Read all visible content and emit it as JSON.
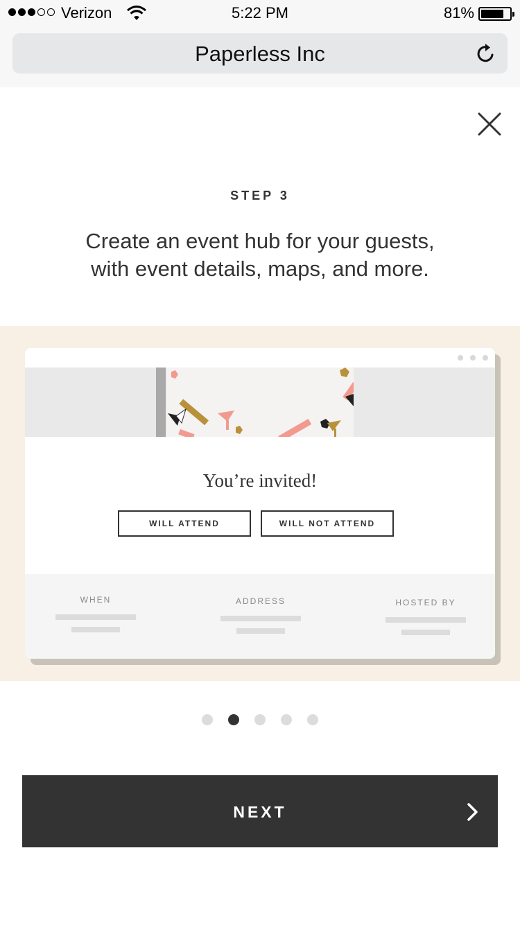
{
  "status_bar": {
    "carrier": "Verizon",
    "signal_bars_filled": 3,
    "signal_bars_total": 5,
    "time": "5:22 PM",
    "battery_percent": "81%",
    "battery_level": 0.81
  },
  "browser": {
    "url_title": "Paperless Inc",
    "reload_icon": "reload-icon"
  },
  "onboarding": {
    "step_label": "STEP 3",
    "headline": "Create an event hub for your guests,\nwith event details, maps, and more.",
    "close_icon": "close-icon"
  },
  "preview_card": {
    "invite_title": "You’re invited!",
    "attend_label": "WILL ATTEND",
    "not_attend_label": "WILL NOT ATTEND",
    "info_labels": [
      "WHEN",
      "ADDRESS",
      "HOSTED BY"
    ]
  },
  "pagination": {
    "total": 5,
    "active_index": 1
  },
  "next_button": {
    "label": "NEXT",
    "icon": "chevron-right-icon"
  },
  "colors": {
    "band_background": "#f8f0e5",
    "button_dark": "#333333",
    "confetti_pink": "#f29a8e",
    "confetti_gold": "#b8913a"
  }
}
